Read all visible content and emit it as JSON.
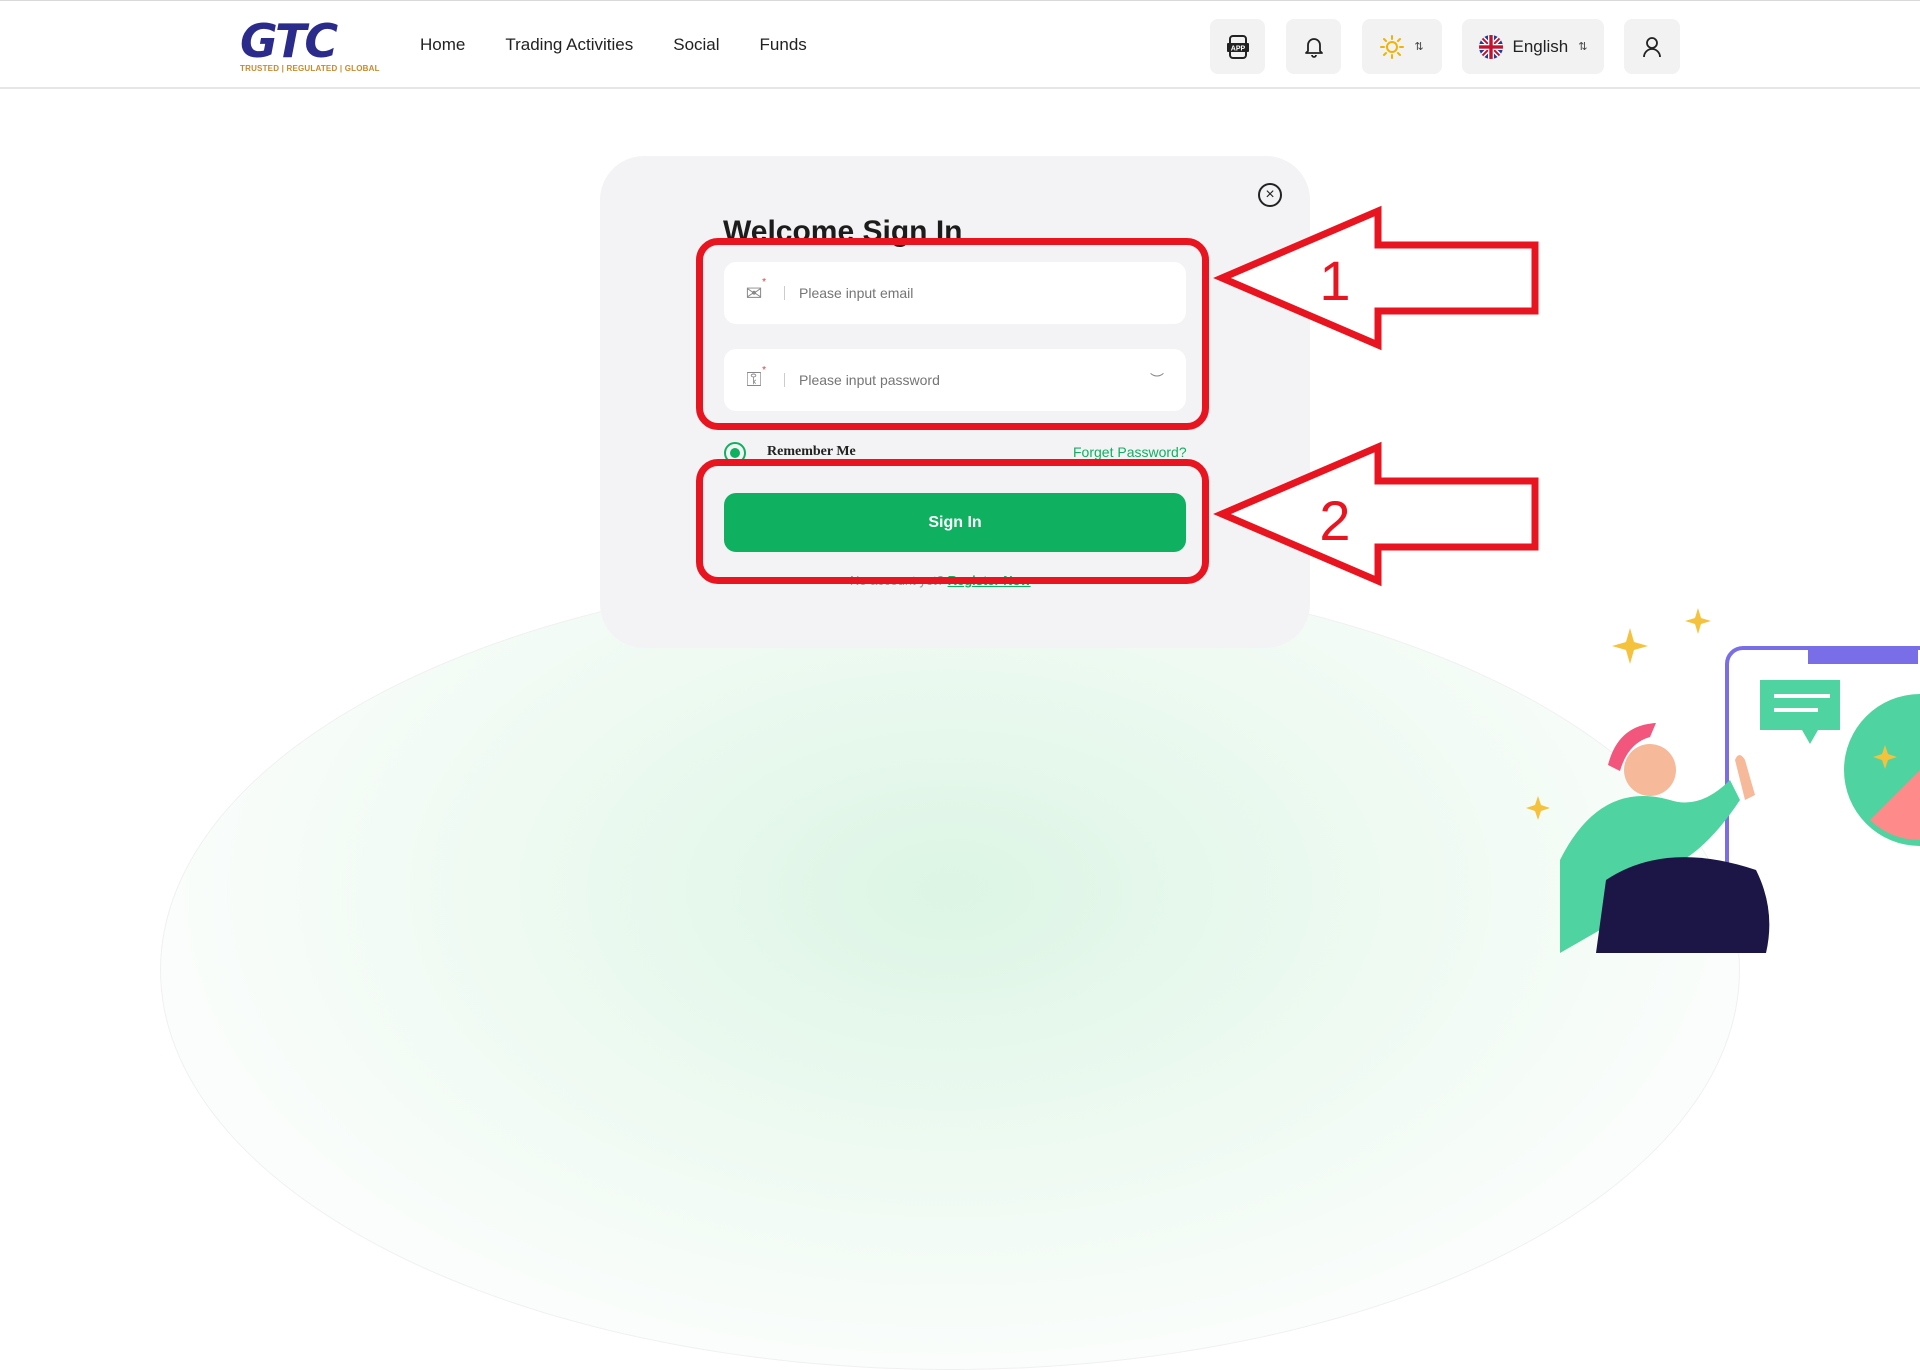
{
  "header": {
    "logo_text": "GTC",
    "logo_tagline": "TRUSTED | REGULATED | GLOBAL",
    "nav": [
      "Home",
      "Trading Activities",
      "Social",
      "Funds"
    ],
    "app_label": "APP",
    "language": "English"
  },
  "modal": {
    "title": "Welcome Sign In",
    "email_placeholder": "Please input email",
    "password_placeholder": "Please input password",
    "remember_label": "Remember Me",
    "forgot_label": "Forget Password?",
    "signin_label": "Sign In",
    "register_prefix": "No account yet?",
    "register_link": "Register Now"
  },
  "annotations": {
    "arrow1_label": "1",
    "arrow2_label": "2",
    "color": "#e8141f"
  },
  "colors": {
    "accent": "#10b061",
    "brand": "#2b2b8c",
    "annotation": "#e8141f"
  }
}
